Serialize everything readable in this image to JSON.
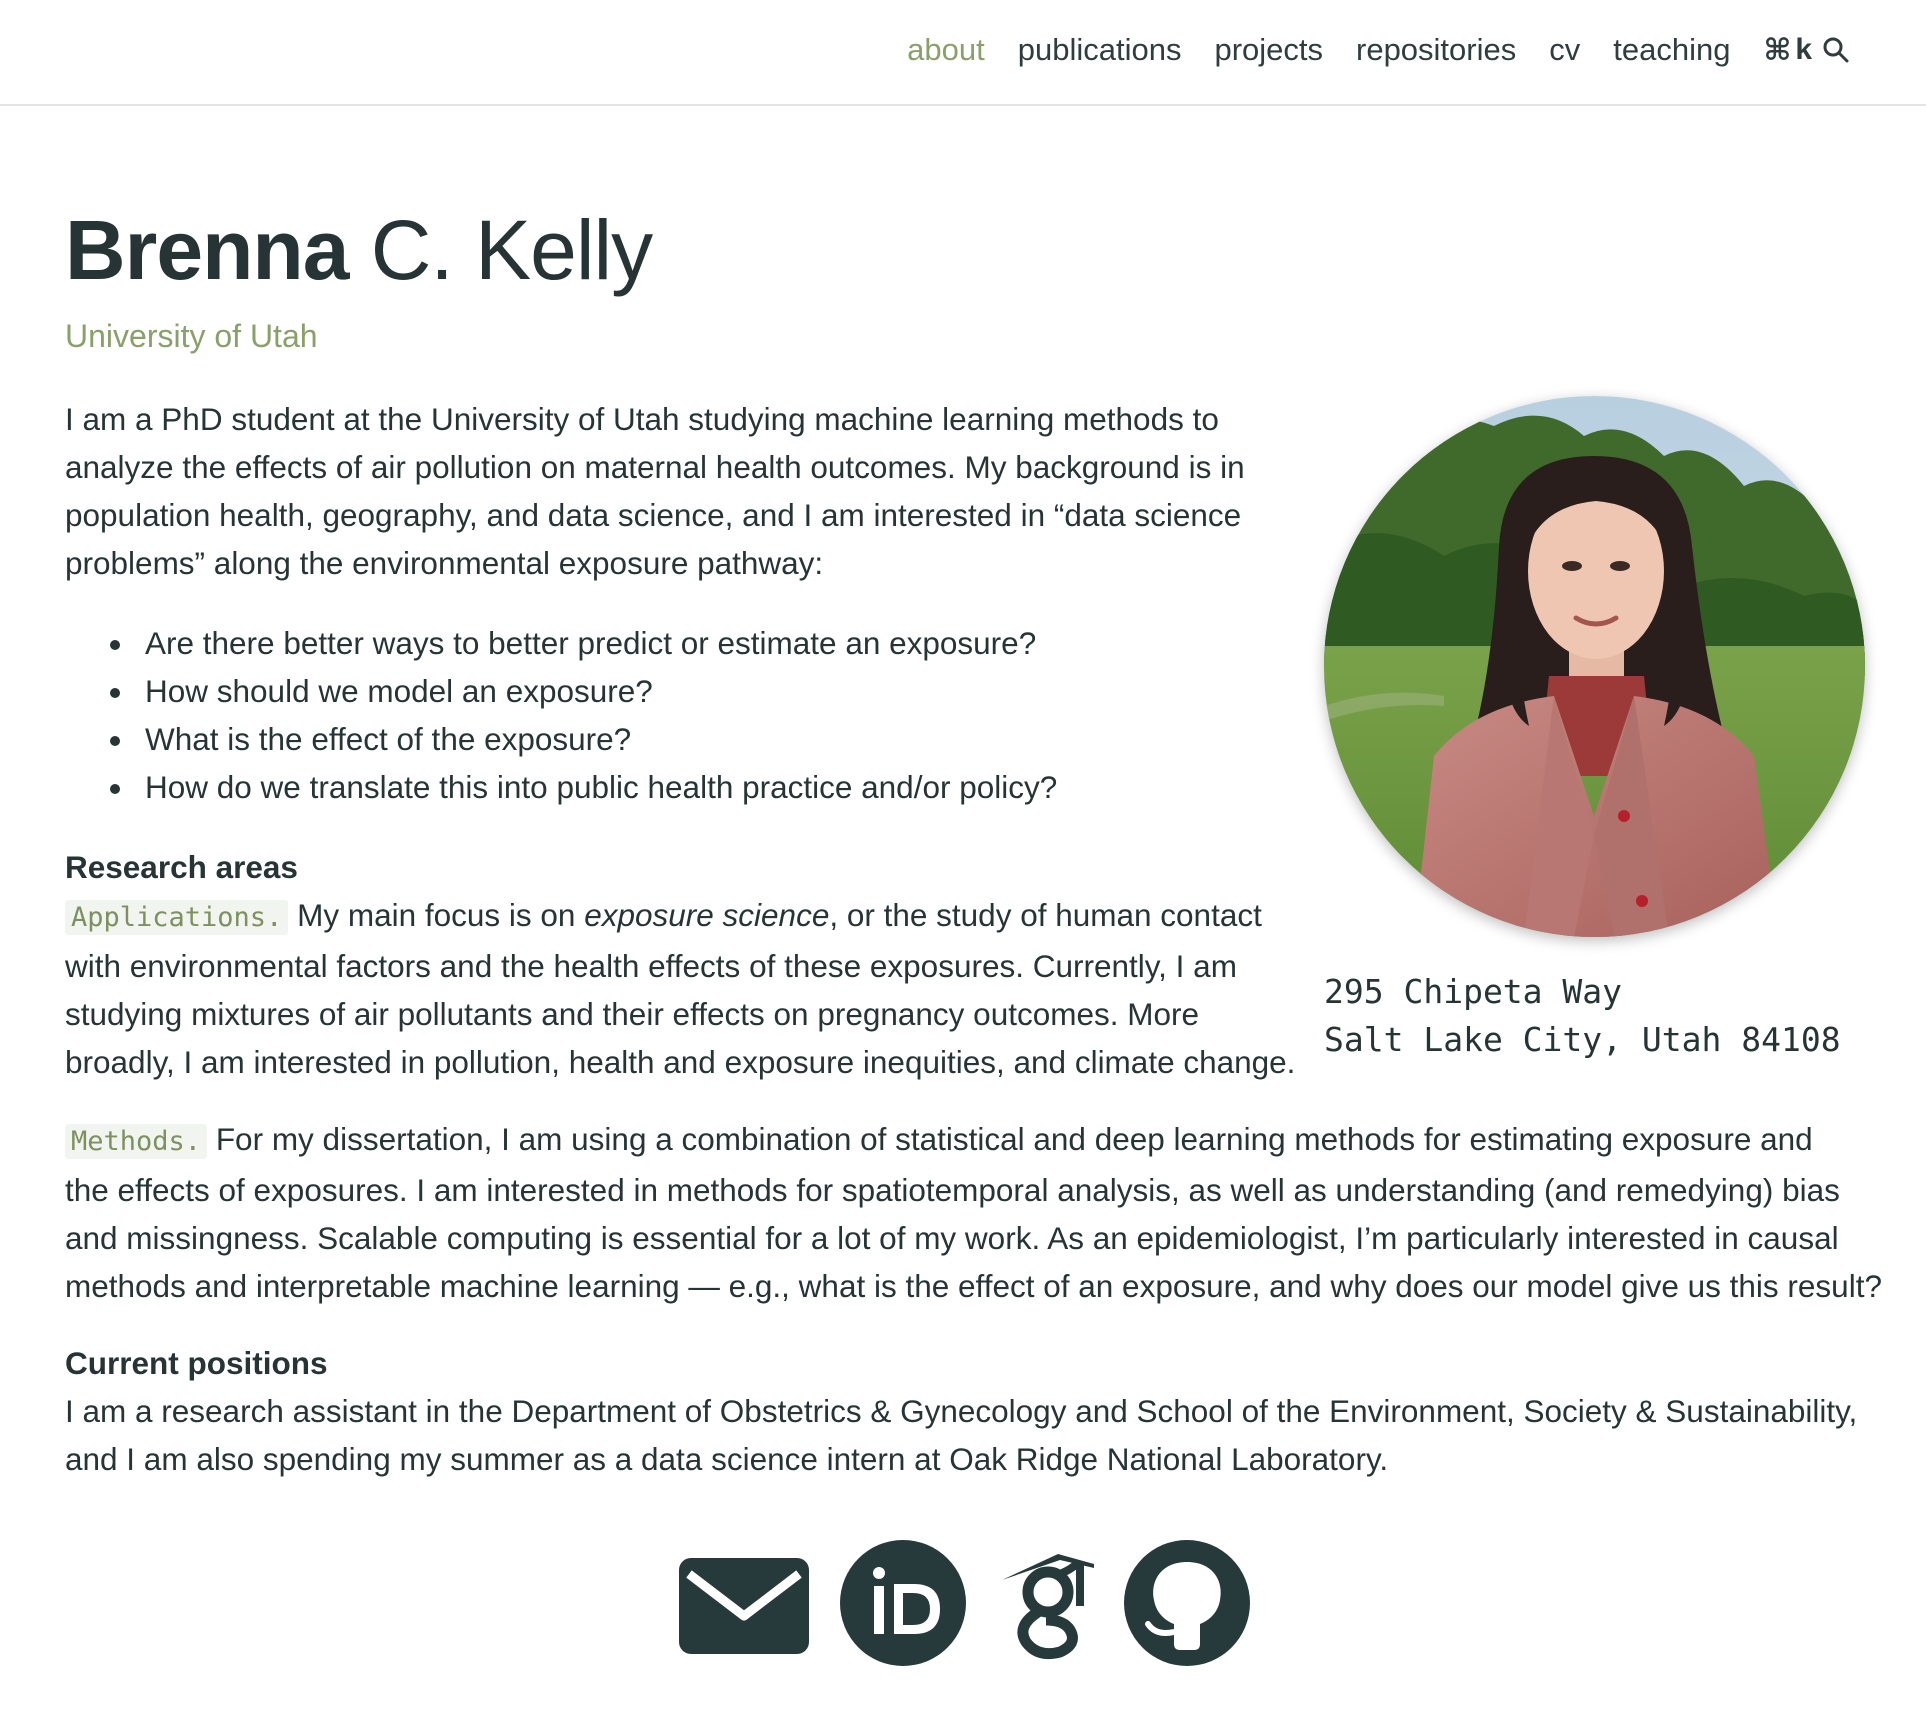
{
  "nav": {
    "items": [
      {
        "label": "about",
        "active": true
      },
      {
        "label": "publications",
        "active": false
      },
      {
        "label": "projects",
        "active": false
      },
      {
        "label": "repositories",
        "active": false
      },
      {
        "label": "cv",
        "active": false
      },
      {
        "label": "teaching",
        "active": false
      }
    ],
    "search_shortcut_symbol": "⌘",
    "search_shortcut_key": "k",
    "search_icon": "search-icon"
  },
  "header": {
    "first_name": "Brenna",
    "rest_name": "C. Kelly",
    "affiliation": "University of Utah"
  },
  "intro": {
    "lines": [
      "I am a PhD student at the University of Utah studying machine learning methods to",
      "analyze the effects of air pollution on maternal health outcomes. My background is in",
      "population health, geography, and data science, and I am interested in “data science",
      "problems” along the environmental exposure pathway:"
    ],
    "questions": [
      "Are there better ways to better predict or estimate an exposure?",
      "How should we model an exposure?",
      "What is the effect of the exposure?",
      "How do we translate this into public health practice and/or policy?"
    ]
  },
  "research": {
    "heading": "Research areas",
    "applications_tag": "Applications.",
    "applications_line1_pre": "My main focus is on ",
    "applications_line1_em": "exposure science",
    "applications_line1_post": ", or the study of human contact",
    "applications_lines": [
      "with environmental factors and the health effects of these exposures. Currently, I am",
      "studying mixtures of air pollutants and their effects on pregnancy outcomes. More",
      "broadly, I am interested in pollution, health and exposure inequities, and climate change."
    ],
    "methods_tag": "Methods.",
    "methods_line1": "For my dissertation, I am using a combination of statistical and deep learning methods for estimating exposure and",
    "methods_lines": [
      "the effects of exposures. I am interested in methods for spatiotemporal analysis, as well as understanding (and remedying) bias",
      "and missingness. Scalable computing is essential for a lot of my work. As an epidemiologist, I’m particularly interested in causal",
      "methods and interpretable machine learning — e.g., what is the effect of an exposure, and why does our model give us this result?"
    ]
  },
  "positions": {
    "heading": "Current positions",
    "lines": [
      "I am a research assistant in the Department of Obstetrics & Gynecology and School of the Environment, Society & Sustainability,",
      "and I am also spending my summer as a data science intern at Oak Ridge National Laboratory."
    ]
  },
  "profile": {
    "address_line1": "295 Chipeta Way",
    "address_line2": "Salt Lake City, Utah 84108"
  },
  "social": [
    {
      "icon": "envelope-icon"
    },
    {
      "icon": "orcid-icon"
    },
    {
      "icon": "google-scholar-icon"
    },
    {
      "icon": "github-icon"
    }
  ],
  "colors": {
    "accent": "#8aa06a",
    "text": "#263436",
    "icon": "#263a3c"
  }
}
